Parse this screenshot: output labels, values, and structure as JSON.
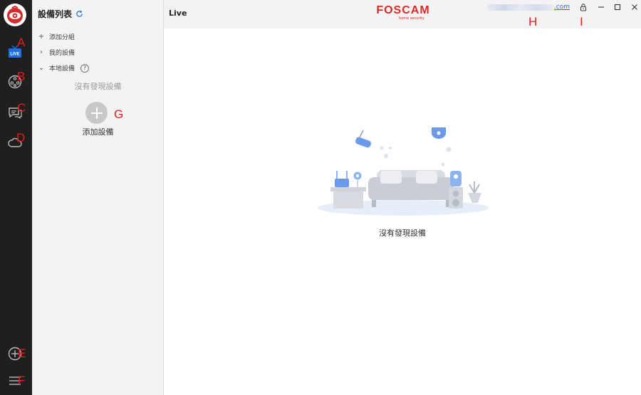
{
  "colors": {
    "brand_red": "#d52b2b",
    "rail_bg": "#1f1f1f",
    "panel_bg": "#f3f3f3",
    "link_blue": "#2f6fd5",
    "live_blue": "#1e6fe0",
    "annotation_red": "#e21f1f"
  },
  "rail": {
    "logo_icon": "foscam-logo-icon",
    "items": [
      {
        "icon": "live-tv-icon",
        "badge": "LIVE",
        "marker": "A"
      },
      {
        "icon": "film-reel-icon",
        "marker": "B"
      },
      {
        "icon": "message-icon",
        "marker": "C"
      },
      {
        "icon": "cloud-icon",
        "marker": "D"
      },
      {
        "icon": "add-circle-icon",
        "marker": "E"
      },
      {
        "icon": "menu-icon",
        "marker": "F"
      }
    ]
  },
  "panel": {
    "title": "設備列表",
    "refresh_icon": "refresh-icon",
    "add_group": "添加分組",
    "my_devices": "我的設備",
    "local_devices": "本地設備",
    "help_glyph": "?",
    "empty_text": "沒有發現設備",
    "add_device": "添加設備",
    "add_marker": "G"
  },
  "topbar": {
    "title": "Live",
    "brand": "FOSCAM",
    "brand_sub": "home security",
    "account_suffix": ".com",
    "account_marker": "H",
    "lock_marker": "I"
  },
  "main": {
    "empty_text": "沒有發現設備"
  }
}
